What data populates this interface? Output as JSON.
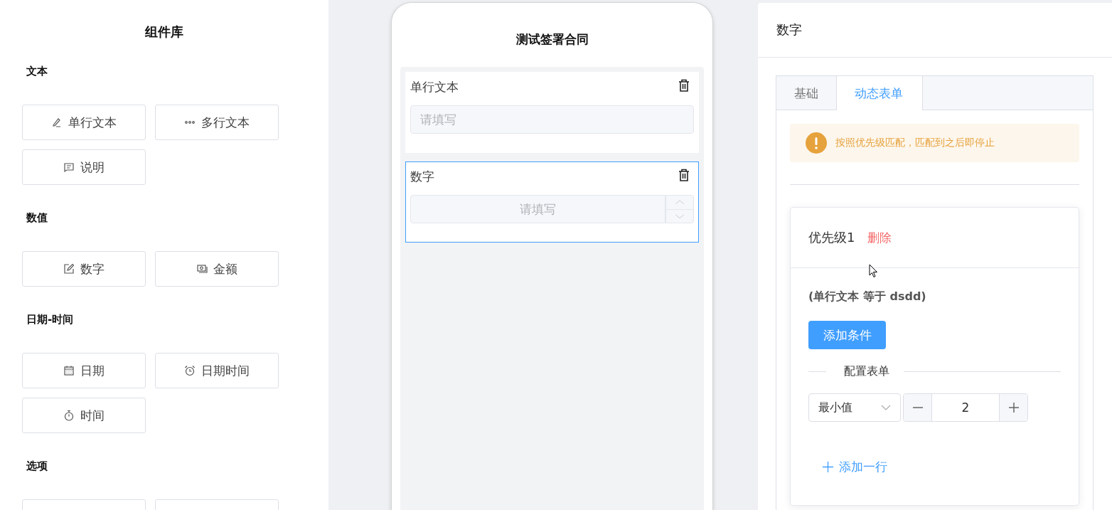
{
  "library": {
    "title": "组件库",
    "groups": [
      {
        "title": "文本",
        "items": [
          {
            "kind": "full",
            "label": "单行文本"
          },
          {
            "kind": "full",
            "label": "多行文本"
          },
          {
            "kind": "full",
            "label": "说明"
          }
        ]
      },
      {
        "title": "数值",
        "items": [
          {
            "kind": "full",
            "label": "数字"
          },
          {
            "kind": "full",
            "label": "金额"
          }
        ]
      },
      {
        "title": "日期-时间",
        "items": [
          {
            "kind": "full",
            "label": "日期"
          },
          {
            "kind": "full",
            "label": "日期时间"
          },
          {
            "kind": "full",
            "label": "时间"
          }
        ]
      },
      {
        "title": "选项",
        "items": [
          {
            "kind": "cut"
          },
          {
            "kind": "cut"
          }
        ]
      }
    ]
  },
  "phone": {
    "title": "测试签署合同",
    "fields": [
      {
        "label": "单行文本",
        "placeholder": "请填写",
        "kind": "text",
        "selected": false
      },
      {
        "label": "数字",
        "placeholder": "请填写",
        "kind": "number",
        "selected": true
      }
    ]
  },
  "panel": {
    "title": "数字",
    "tabs": [
      {
        "label": "基础",
        "selected": false
      },
      {
        "label": "动态表单",
        "selected": true
      }
    ],
    "alert": "按照优先级匹配，匹配到之后即停止",
    "rules": [
      {
        "title": "优先级1",
        "delete": "删除",
        "condition": "(单行文本 等于 dsdd)",
        "add_condition": "添加条件",
        "section": "配置表单",
        "rows": [
          {
            "select": "最小值",
            "value": "2"
          }
        ],
        "add_row": "添加一行"
      }
    ]
  }
}
